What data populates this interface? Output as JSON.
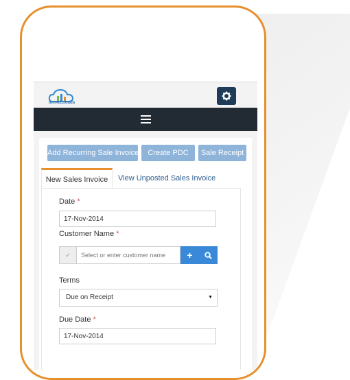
{
  "app": {
    "logo_text": "move2clouds"
  },
  "icons": {
    "settings": "gear-icon",
    "menu": "hamburger-icon",
    "add": "plus-icon",
    "search": "search-icon"
  },
  "colors": {
    "phone_frame": "#e5902c",
    "navbar": "#222a33",
    "button": "#8fb4da",
    "action": "#3a89d9",
    "tab_accent": "#e5902c"
  },
  "actions": {
    "add_recurring": "Add Recurring Sale Invoice",
    "create_pdc": "Create PDC",
    "sale_receipt": "Sale Receipt"
  },
  "tabs": {
    "active": "New Sales Invoice",
    "other": "View Unposted Sales Invoice"
  },
  "form": {
    "date_label": "Date",
    "date_value": "17-Nov-2014",
    "customer_label": "Customer Name",
    "customer_placeholder": "Select or enter customer name",
    "customer_checkbox": "✓",
    "terms_label": "Terms",
    "terms_value": "Due on Receipt",
    "due_date_label": "Due Date",
    "due_date_value": "17-Nov-2014",
    "required_mark": "*"
  }
}
